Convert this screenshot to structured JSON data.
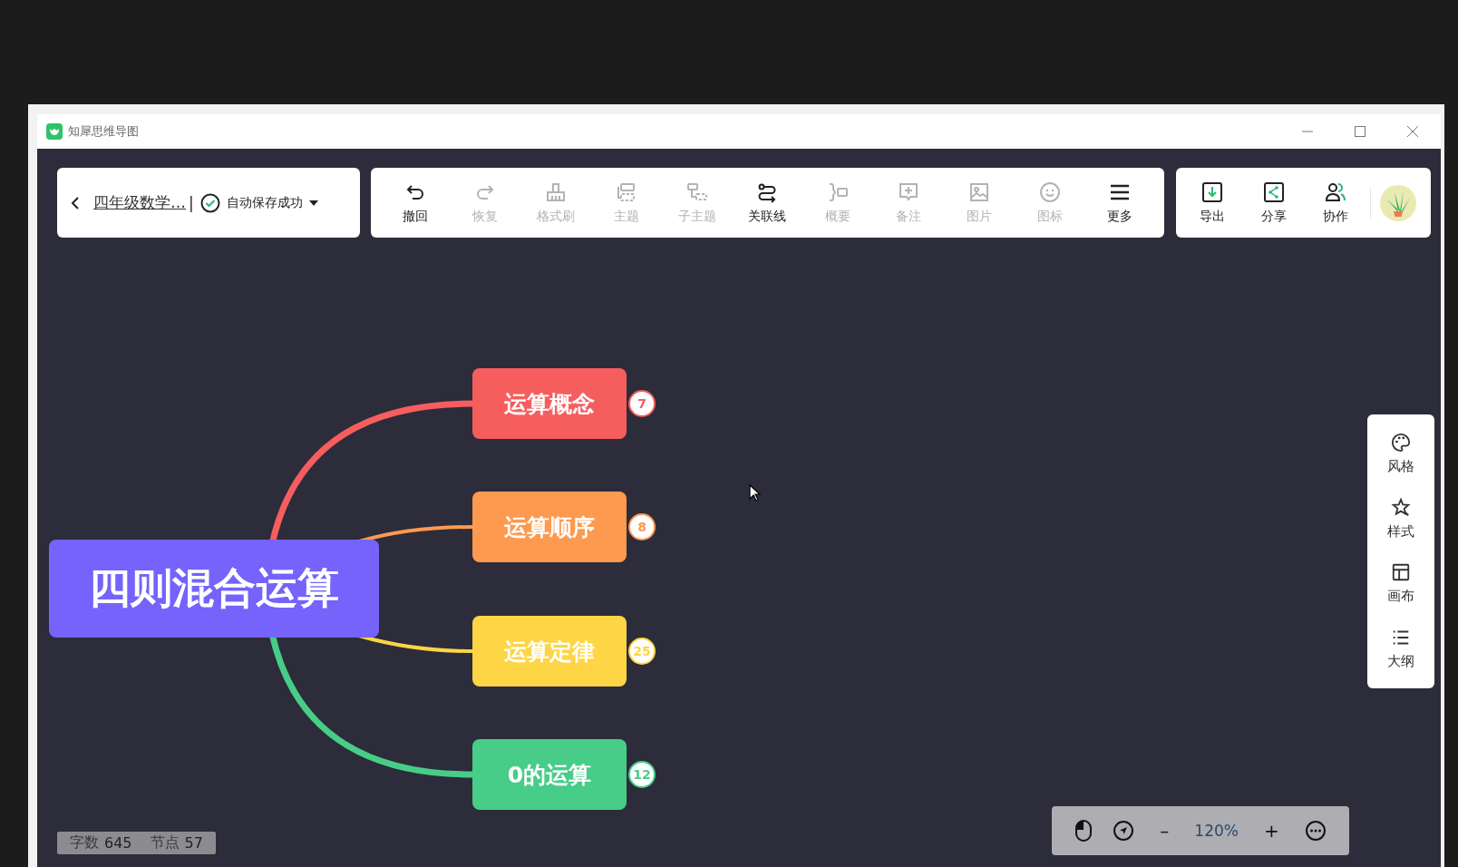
{
  "app": {
    "title": "知犀思维导图"
  },
  "document": {
    "title": "四年级数学…",
    "separator": "|",
    "save_status": "自动保存成功"
  },
  "toolbar": [
    {
      "label": "撤回",
      "disabled": false
    },
    {
      "label": "恢复",
      "disabled": true
    },
    {
      "label": "格式刷",
      "disabled": true
    },
    {
      "label": "主题",
      "disabled": true
    },
    {
      "label": "子主题",
      "disabled": true
    },
    {
      "label": "关联线",
      "disabled": false
    },
    {
      "label": "概要",
      "disabled": true
    },
    {
      "label": "备注",
      "disabled": true
    },
    {
      "label": "图片",
      "disabled": true
    },
    {
      "label": "图标",
      "disabled": true
    },
    {
      "label": "更多",
      "disabled": false
    }
  ],
  "share_tools": [
    {
      "label": "导出"
    },
    {
      "label": "分享"
    },
    {
      "label": "协作"
    }
  ],
  "mindmap": {
    "root": "四则混合运算",
    "branches": [
      {
        "label": "运算概念",
        "count": "7",
        "color": "#f65e5e"
      },
      {
        "label": "运算顺序",
        "count": "8",
        "color": "#fd9a4f"
      },
      {
        "label": "运算定律",
        "count": "25",
        "color": "#fdd545"
      },
      {
        "label": "0的运算",
        "count": "12",
        "color": "#47cd87"
      }
    ]
  },
  "side_panel": [
    {
      "label": "风格"
    },
    {
      "label": "样式"
    },
    {
      "label": "画布"
    },
    {
      "label": "大纲"
    }
  ],
  "status": {
    "word_label": "字数",
    "word_count": "645",
    "node_label": "节点",
    "node_count": "57"
  },
  "zoom": {
    "minus": "–",
    "value": "120%",
    "plus": "+"
  }
}
